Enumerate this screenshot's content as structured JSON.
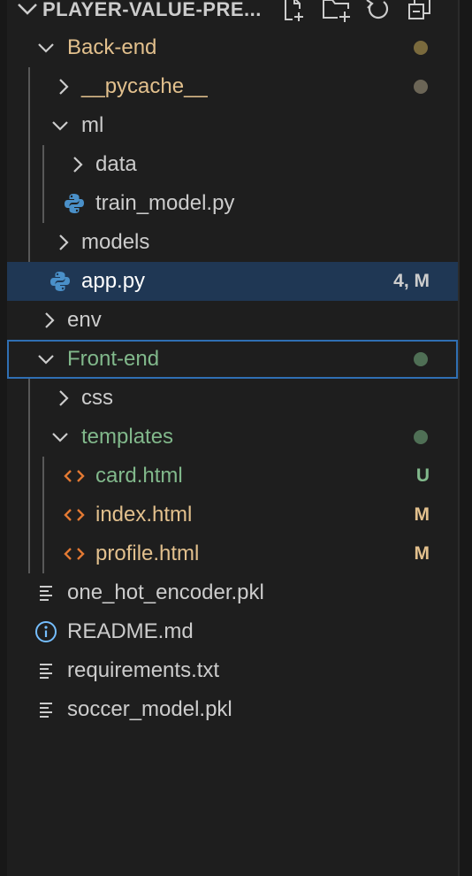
{
  "explorer": {
    "title": "PLAYER-VALUE-PRE...",
    "actions": [
      "new-file-icon",
      "new-folder-icon",
      "refresh-icon",
      "collapse-all-icon"
    ]
  },
  "tree": {
    "back_end": {
      "label": "Back-end"
    },
    "pycache": {
      "label": "__pycache__"
    },
    "ml": {
      "label": "ml"
    },
    "data": {
      "label": "data"
    },
    "train_model": {
      "label": "train_model.py"
    },
    "models": {
      "label": "models"
    },
    "app": {
      "label": "app.py",
      "status": "4, M"
    },
    "env": {
      "label": "env"
    },
    "front_end": {
      "label": "Front-end"
    },
    "css": {
      "label": "css"
    },
    "templates": {
      "label": "templates"
    },
    "card": {
      "label": "card.html",
      "status": "U"
    },
    "index": {
      "label": "index.html",
      "status": "M"
    },
    "profile": {
      "label": "profile.html",
      "status": "M"
    },
    "one_hot": {
      "label": "one_hot_encoder.pkl"
    },
    "readme": {
      "label": "README.md"
    },
    "requirements": {
      "label": "requirements.txt"
    },
    "soccer": {
      "label": "soccer_model.pkl"
    }
  },
  "colors": {
    "modified": "#e2c08d",
    "untracked": "#81b88b",
    "modified_dot": "#7a6a3d",
    "untracked_dot": "#4f6f55",
    "selection": "#1f3754",
    "focus_border": "#2f6fb3"
  }
}
